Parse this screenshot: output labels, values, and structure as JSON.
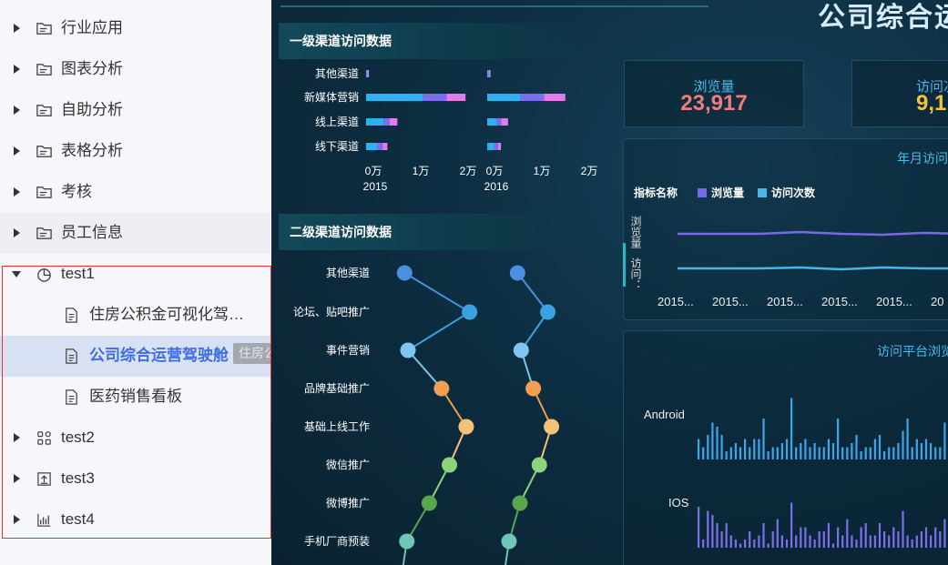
{
  "sidebar": {
    "items": [
      {
        "label": "行业应用",
        "icon": "folder-icon"
      },
      {
        "label": "图表分析",
        "icon": "folder-icon"
      },
      {
        "label": "自助分析",
        "icon": "folder-icon"
      },
      {
        "label": "表格分析",
        "icon": "folder-icon"
      },
      {
        "label": "考核",
        "icon": "folder-icon"
      },
      {
        "label": "员工信息",
        "icon": "folder-icon"
      },
      {
        "label": "test1",
        "icon": "pie-chart-icon"
      },
      {
        "label": "test2",
        "icon": "grid-icon"
      },
      {
        "label": "test3",
        "icon": "upload-icon"
      },
      {
        "label": "test4",
        "icon": "bar-chart-icon"
      }
    ],
    "test1_children": [
      {
        "label": "住房公积金可视化驾…",
        "icon": "document-icon"
      },
      {
        "label": "公司综合运营驾驶舱",
        "icon": "document-icon"
      },
      {
        "label": "医药销售看板",
        "icon": "document-icon"
      }
    ],
    "tooltip": "住房公积金可视化驾驶舱"
  },
  "dashboard": {
    "title": "公司综合运",
    "panel1_title": "一级渠道访问数据",
    "panel2_title": "二级渠道访问数据",
    "kpis": [
      {
        "label": "浏览量",
        "value": "23,917",
        "color": "#f07c7c"
      },
      {
        "label": "访问次",
        "value": "9,1",
        "color": "#f5c33b"
      }
    ],
    "trend_title": "年月访问",
    "trend_legend": {
      "name_label": "指标名称",
      "series": [
        "浏览量",
        "访问次数"
      ]
    },
    "trend_ylabels": [
      "浏览量",
      "访问："
    ],
    "trend_xticks": [
      "2015...",
      "2015...",
      "2015...",
      "2015...",
      "2015...",
      "20"
    ],
    "platform_title": "访问平台浏览",
    "platform_rows": [
      "Android",
      "IOS"
    ]
  },
  "chart_data": [
    {
      "type": "bar",
      "title": "一级渠道访问数据",
      "categories": [
        "其他渠道",
        "新媒体营销",
        "线上渠道",
        "线下渠道"
      ],
      "facets": [
        "2015",
        "2016"
      ],
      "xticks": [
        "0万",
        "1万",
        "2万"
      ],
      "xlim": [
        0,
        20000
      ],
      "series_colors": [
        "#2fb0f0",
        "#7b6cf0",
        "#e57ae8"
      ],
      "values_2015": [
        [
          200,
          100,
          100
        ],
        [
          12000,
          5000,
          4000
        ],
        [
          3700,
          1300,
          1600
        ],
        [
          2300,
          1200,
          1000
        ]
      ],
      "values_2016": [
        [
          300,
          100,
          100
        ],
        [
          7000,
          5000,
          4500
        ],
        [
          2000,
          1000,
          1400
        ],
        [
          1500,
          800,
          600
        ]
      ]
    },
    {
      "type": "line",
      "title": "二级渠道访问数据",
      "categories": [
        "其他渠道",
        "论坛、贴吧推广",
        "事件营销",
        "品牌基础推广",
        "基础上线工作",
        "微信推广",
        "微博推广",
        "手机厂商预装"
      ],
      "point_colors": [
        "#4a8fe0",
        "#3aa2e0",
        "#7ec6f0",
        "#f0a050",
        "#f5c07a",
        "#8ad47a",
        "#5aa64e",
        "#6ec6b8"
      ],
      "series": [
        {
          "values": [
            1.0,
            6.8,
            1.3,
            4.3,
            6.5,
            5.0,
            3.2,
            1.2
          ]
        },
        {
          "values": [
            1.0,
            3.5,
            1.3,
            2.3,
            3.8,
            2.8,
            1.2,
            0.3
          ]
        }
      ]
    },
    {
      "type": "line",
      "title": "年月访问",
      "series": [
        {
          "name": "浏览量",
          "color": "#7868e8",
          "values": [
            5.0,
            5.0,
            5.0,
            5.2,
            5.0,
            4.9,
            5.1,
            5.0
          ]
        },
        {
          "name": "访问次数",
          "color": "#4ab6e8",
          "values": [
            1.0,
            1.0,
            1.0,
            1.1,
            0.9,
            1.1,
            1.0,
            1.0
          ]
        }
      ]
    },
    {
      "type": "bar",
      "title": "访问平台浏览",
      "categories": [
        "Android",
        "IOS"
      ],
      "series": [
        {
          "name": "Android",
          "color": "#3aa7e8",
          "values": [
            5,
            3,
            6,
            9,
            8,
            6,
            2,
            3,
            4,
            3,
            5,
            3,
            5,
            5,
            10,
            2,
            3,
            3,
            4,
            5,
            15,
            3,
            4,
            5,
            3,
            4,
            3,
            3,
            5,
            4,
            10,
            3,
            3,
            4,
            6,
            2,
            3,
            3,
            5,
            6,
            2,
            3,
            3,
            4,
            7,
            10,
            3,
            5,
            4,
            5,
            4,
            3,
            3,
            9,
            4,
            3,
            5,
            4,
            3,
            6
          ]
        },
        {
          "name": "IOS",
          "color": "#7b70e8",
          "values": [
            10,
            2,
            9,
            8,
            6,
            4,
            6,
            3,
            2,
            1,
            2,
            4,
            2,
            3,
            6,
            1,
            4,
            7,
            3,
            2,
            11,
            3,
            5,
            5,
            3,
            2,
            4,
            4,
            6,
            1,
            5,
            3,
            7,
            3,
            2,
            5,
            6,
            3,
            3,
            6,
            4,
            3,
            5,
            4,
            9,
            3,
            2,
            3,
            4,
            5,
            3,
            5,
            4,
            7,
            3,
            4,
            3,
            5,
            4,
            6
          ]
        }
      ]
    }
  ]
}
